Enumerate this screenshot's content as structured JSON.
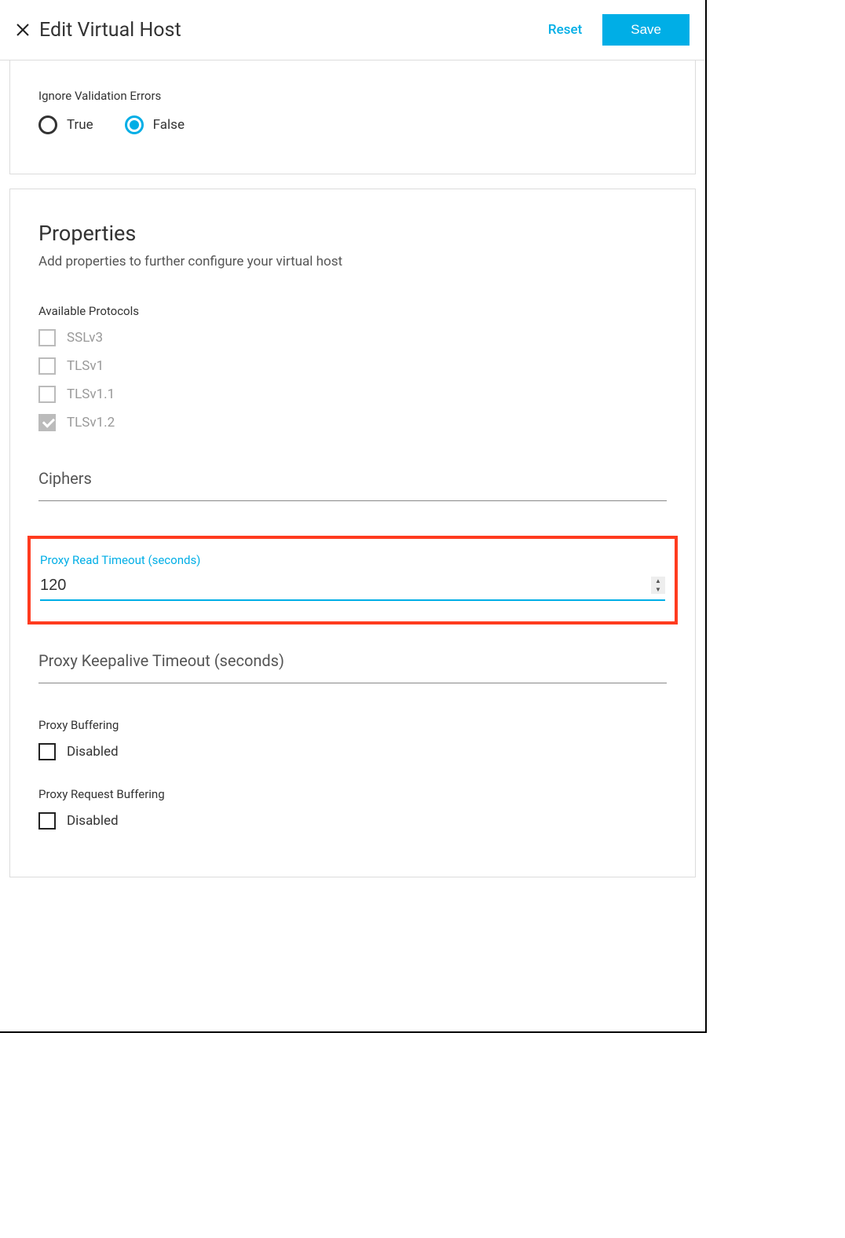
{
  "header": {
    "title": "Edit Virtual Host",
    "reset_label": "Reset",
    "save_label": "Save"
  },
  "validation": {
    "label": "Ignore Validation Errors",
    "true_label": "True",
    "false_label": "False",
    "selected": "False"
  },
  "properties": {
    "title": "Properties",
    "subtitle": "Add properties to further configure your virtual host",
    "protocols_label": "Available Protocols",
    "protocols": [
      {
        "label": "SSLv3",
        "checked": false
      },
      {
        "label": "TLSv1",
        "checked": false
      },
      {
        "label": "TLSv1.1",
        "checked": false
      },
      {
        "label": "TLSv1.2",
        "checked": true
      }
    ],
    "ciphers_label": "Ciphers",
    "proxy_read_timeout_label": "Proxy Read Timeout (seconds)",
    "proxy_read_timeout_value": "120",
    "proxy_keepalive_label": "Proxy Keepalive Timeout (seconds)",
    "proxy_buffering_label": "Proxy Buffering",
    "proxy_buffering_option": "Disabled",
    "proxy_request_buffering_label": "Proxy Request Buffering",
    "proxy_request_buffering_option": "Disabled"
  }
}
